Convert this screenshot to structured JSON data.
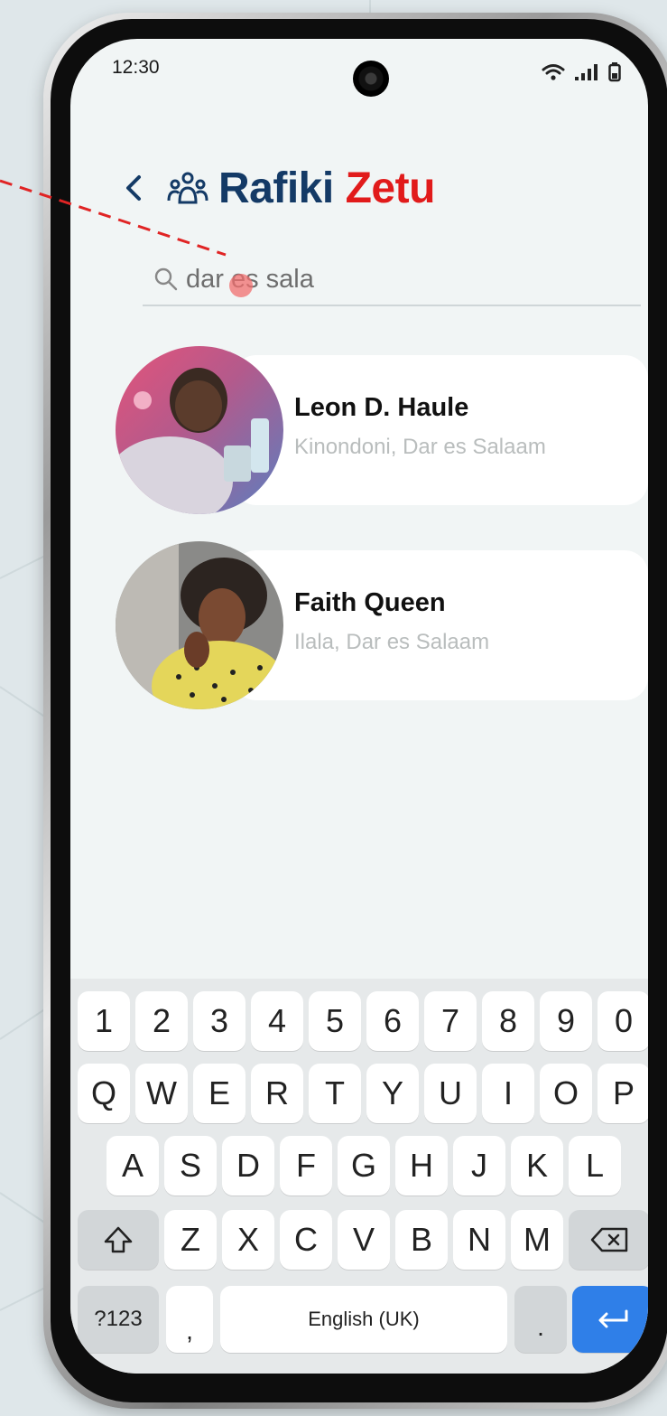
{
  "status_bar": {
    "time": "12:30"
  },
  "header": {
    "title_part1": "Rafiki",
    "title_part2": "Zetu",
    "icons": [
      "back-chevron-icon",
      "people-group-icon"
    ]
  },
  "search": {
    "value": "dar es sala"
  },
  "results": [
    {
      "name": "Leon D. Haule",
      "location": "Kinondoni, Dar es Salaam"
    },
    {
      "name": "Faith Queen",
      "location": "Ilala, Dar es Salaam"
    }
  ],
  "keyboard": {
    "row_numbers": [
      "1",
      "2",
      "3",
      "4",
      "5",
      "6",
      "7",
      "8",
      "9",
      "0"
    ],
    "row1": [
      "Q",
      "W",
      "E",
      "R",
      "T",
      "Y",
      "U",
      "I",
      "O",
      "P"
    ],
    "row2": [
      "A",
      "S",
      "D",
      "F",
      "G",
      "H",
      "J",
      "K",
      "L"
    ],
    "row3": [
      "Z",
      "X",
      "C",
      "V",
      "B",
      "N",
      "M"
    ],
    "symbols_label": "?123",
    "comma_label": ",",
    "space_label": "English (UK)",
    "period_label": ".",
    "enter_color": "#2f7fe8"
  },
  "colors": {
    "title_blue": "#143a66",
    "title_red": "#e11b1b",
    "screen_bg": "#f1f5f5"
  }
}
